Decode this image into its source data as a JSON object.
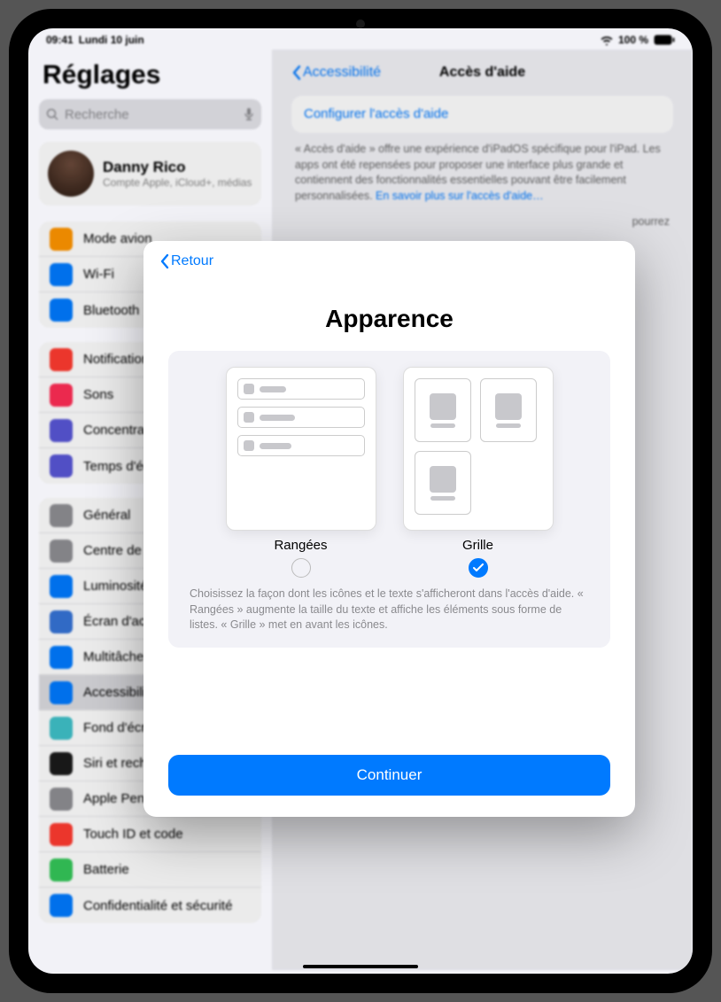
{
  "status": {
    "time": "09:41",
    "date": "Lundi 10 juin",
    "battery": "100 %"
  },
  "sidebar": {
    "title": "Réglages",
    "search_placeholder": "Recherche",
    "account": {
      "name": "Danny Rico",
      "sub": "Compte Apple, iCloud+, médias"
    },
    "g1": [
      {
        "label": "Mode avion",
        "color": "#ff9500"
      },
      {
        "label": "Wi-Fi",
        "color": "#007aff"
      },
      {
        "label": "Bluetooth",
        "color": "#007aff"
      }
    ],
    "g2": [
      {
        "label": "Notifications",
        "color": "#ff3b30"
      },
      {
        "label": "Sons",
        "color": "#ff2d55"
      },
      {
        "label": "Concentration",
        "color": "#5856d6"
      },
      {
        "label": "Temps d'écran",
        "color": "#5856d6"
      }
    ],
    "g3": [
      {
        "label": "Général",
        "color": "#8e8e93"
      },
      {
        "label": "Centre de contrôle",
        "color": "#8e8e93"
      },
      {
        "label": "Luminosité et affichage",
        "color": "#007aff"
      },
      {
        "label": "Écran d'accueil",
        "color": "#3573d6"
      },
      {
        "label": "Multitâche",
        "color": "#007aff"
      },
      {
        "label": "Accessibilité",
        "color": "#007aff",
        "selected": true
      },
      {
        "label": "Fond d'écran",
        "color": "#3fc1c9"
      },
      {
        "label": "Siri et recherche",
        "color": "#1a1a1a"
      },
      {
        "label": "Apple Pencil",
        "color": "#8e8e93"
      },
      {
        "label": "Touch ID et code",
        "color": "#ff3b30"
      },
      {
        "label": "Batterie",
        "color": "#34c759"
      },
      {
        "label": "Confidentialité et sécurité",
        "color": "#007aff"
      }
    ]
  },
  "detail": {
    "back": "Accessibilité",
    "title": "Accès d'aide",
    "config_link": "Configurer l'accès d'aide",
    "desc1": "« Accès d'aide » offre une expérience d'iPadOS spécifique pour l'iPad. Les apps ont été repensées pour proposer une interface plus grande et contiennent des fonctionnalités essentielles pouvant être facilement personnalisées. ",
    "learn_more": "En savoir plus sur l'accès d'aide…",
    "desc2_tail": " pourrez"
  },
  "modal": {
    "back": "Retour",
    "title": "Apparence",
    "option_rows": "Rangées",
    "option_grid": "Grille",
    "hint": "Choisissez la façon dont les icônes et le texte s'afficheront dans l'accès d'aide. « Rangées » augmente la taille du texte et affiche les éléments sous forme de listes. « Grille » met en avant les icônes.",
    "continue": "Continuer"
  }
}
